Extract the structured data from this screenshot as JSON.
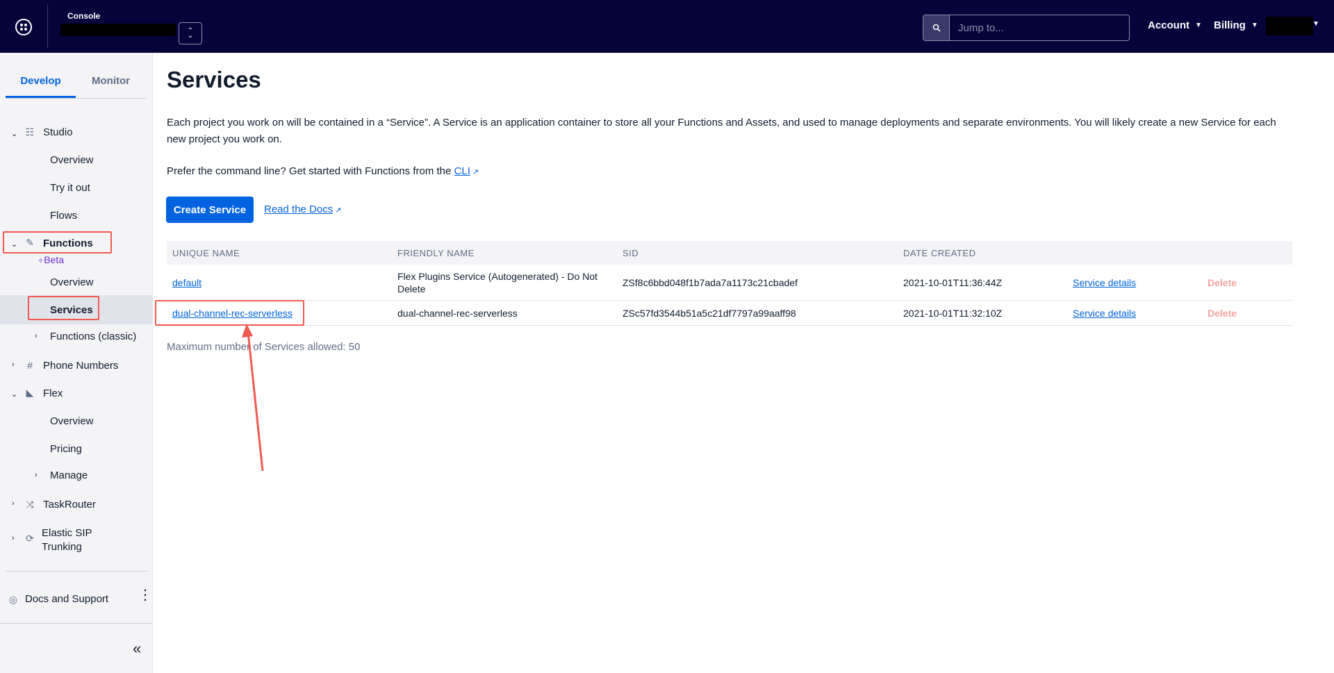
{
  "topbar": {
    "console_label": "Console",
    "search_placeholder": "Jump to...",
    "account_label": "Account",
    "billing_label": "Billing"
  },
  "sidebar": {
    "tabs": [
      "Develop",
      "Monitor"
    ],
    "studio": {
      "label": "Studio",
      "items": [
        "Overview",
        "Try it out",
        "Flows"
      ]
    },
    "functions": {
      "label": "Functions",
      "badge": "Beta",
      "items": [
        "Overview",
        "Services",
        "Functions (classic)"
      ]
    },
    "phone_numbers": "Phone Numbers",
    "flex": {
      "label": "Flex",
      "items": [
        "Overview",
        "Pricing",
        "Manage"
      ]
    },
    "taskrouter": "TaskRouter",
    "elastic_sip": "Elastic SIP Trunking",
    "docs_support": "Docs and Support"
  },
  "main": {
    "title": "Services",
    "description": "Each project you work on will be contained in a “Service”. A Service is an application container to store all your Functions and Assets, and used to manage deployments and separate environments. You will likely create a new Service for each new project you work on.",
    "cli_prefix": "Prefer the command line? Get started with Functions from the",
    "cli_link": "CLI",
    "create_button": "Create Service",
    "docs_link": "Read the Docs",
    "table": {
      "headers": [
        "UNIQUE NAME",
        "FRIENDLY NAME",
        "SID",
        "DATE CREATED"
      ],
      "rows": [
        {
          "unique_name": "default",
          "friendly_name": "Flex Plugins Service (Autogenerated) - Do Not Delete",
          "sid": "ZSf8c6bbd048f1b7ada7a1173c21cbadef",
          "date_created": "2021-10-01T11:36:44Z",
          "details": "Service details",
          "delete": "Delete"
        },
        {
          "unique_name": "dual-channel-rec-serverless",
          "friendly_name": "dual-channel-rec-serverless",
          "sid": "ZSc57fd3544b51a5c21df7797a99aaff98",
          "date_created": "2021-10-01T11:32:10Z",
          "details": "Service details",
          "delete": "Delete"
        }
      ]
    },
    "max_note": "Maximum number of Services allowed: 50"
  },
  "colors": {
    "topbar_bg": "#06033a",
    "accent_blue": "#0263e0",
    "highlight_red": "#f05a50",
    "beta_purple": "#6d2ed1"
  }
}
